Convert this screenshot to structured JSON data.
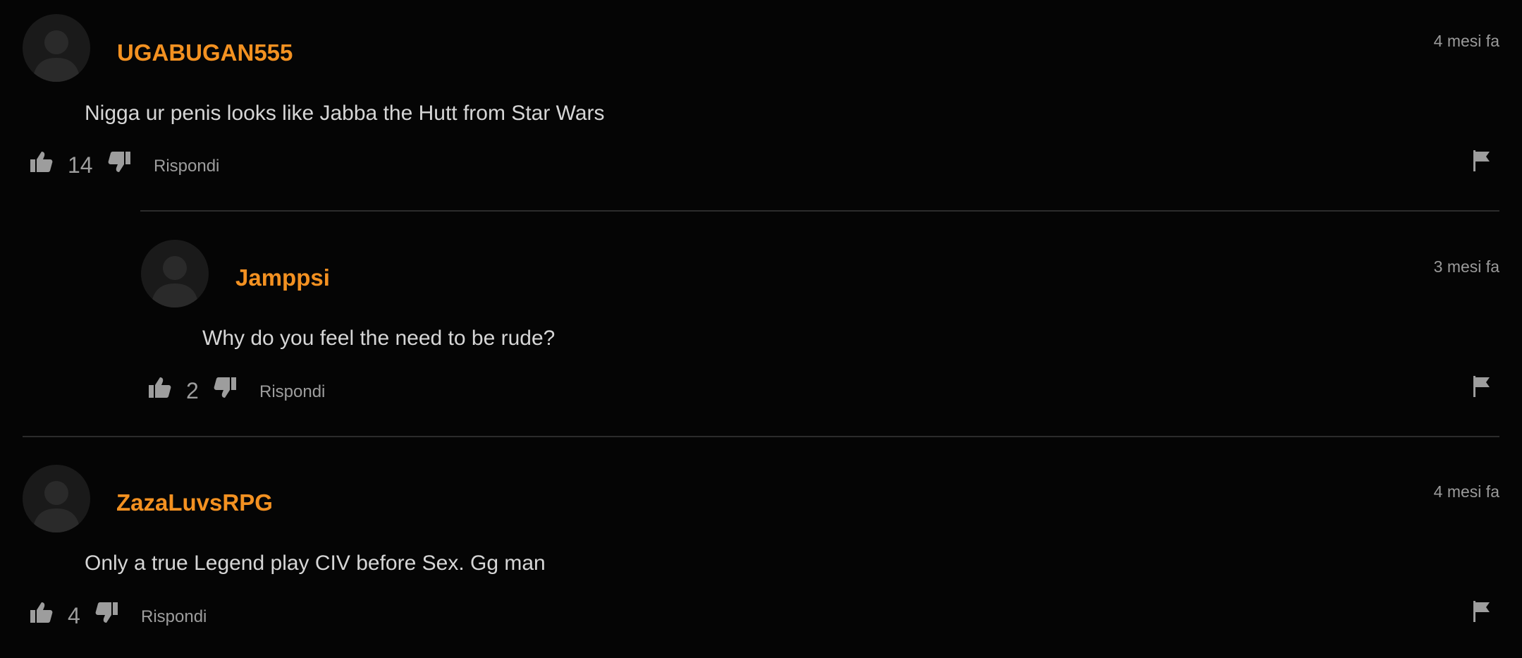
{
  "comments": [
    {
      "username": "UGABUGAN555",
      "time": "4 mesi fa",
      "text": "Nigga ur penis looks like Jabba the Hutt from Star Wars",
      "likes": "14",
      "reply_label": "Rispondi"
    },
    {
      "username": "Jamppsi",
      "time": "3 mesi fa",
      "text": "Why do you feel the need to be rude?",
      "likes": "2",
      "reply_label": "Rispondi"
    },
    {
      "username": "ZazaLuvsRPG",
      "time": "4 mesi fa",
      "text": "Only a true Legend play CIV before Sex. Gg man",
      "likes": "4",
      "reply_label": "Rispondi"
    }
  ],
  "icons": {
    "avatar": "avatar-placeholder-icon",
    "like": "thumbs-up-icon",
    "dislike": "thumbs-down-icon",
    "report": "flag-icon"
  },
  "colors": {
    "background": "#050505",
    "username": "#f39121",
    "text": "#d6d6d6",
    "muted": "#9d9d9d"
  }
}
